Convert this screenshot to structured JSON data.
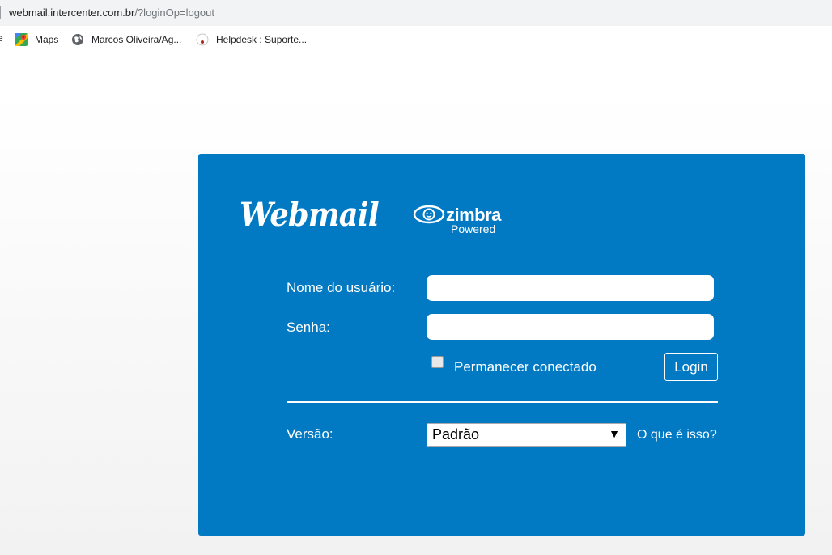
{
  "browser": {
    "url_host": "webmail.intercenter.com.br",
    "url_path": "/?loginOp=logout",
    "bookmarks": [
      {
        "label": "Maps",
        "icon": "maps-icon"
      },
      {
        "label": "Marcos Oliveira/Ag...",
        "icon": "globe-icon"
      },
      {
        "label": "Helpdesk : Suporte...",
        "icon": "helpdesk-icon"
      }
    ],
    "bookmark_edge": "e"
  },
  "branding": {
    "logo_text": "Webmail",
    "zimbra_name": "zimbra",
    "zimbra_tagline": "Powered"
  },
  "form": {
    "username_label": "Nome do usuário:",
    "username_value": "",
    "password_label": "Senha:",
    "password_value": "",
    "remember_label": "Permanecer conectado",
    "remember_checked": false,
    "login_label": "Login",
    "version_label": "Versão:",
    "version_selected": "Padrão",
    "help_link": "O que é isso?"
  },
  "colors": {
    "panel": "#0179c3",
    "text": "#ffffff"
  }
}
